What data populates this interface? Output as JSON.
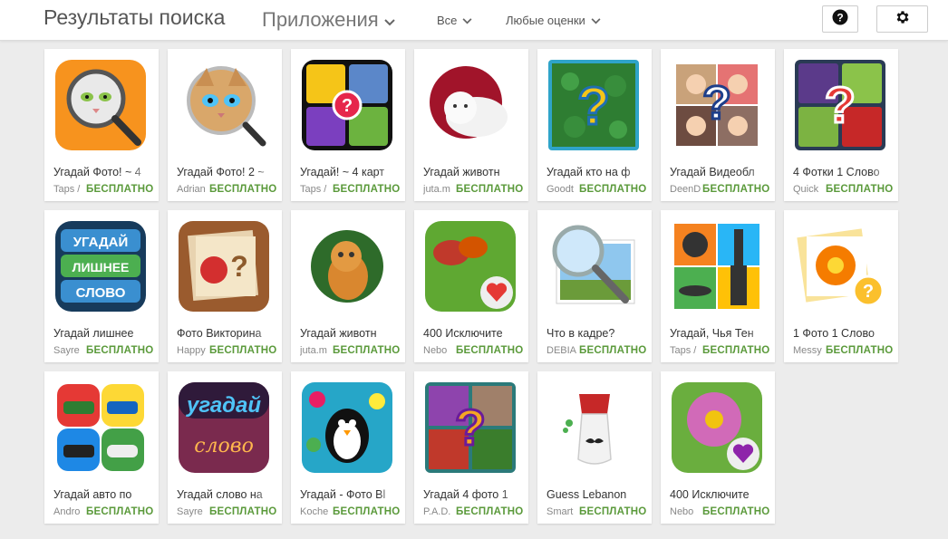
{
  "header": {
    "title": "Результаты поиска",
    "category": "Приложения",
    "filter_all": "Все",
    "filter_rating": "Любые оценки",
    "help_icon": "help-circle-icon",
    "settings_icon": "gear-icon"
  },
  "accent": {
    "price": "#5b9a3b"
  },
  "apps": [
    {
      "title": "Угадай Фото! ~ 4",
      "developer": "Taps / ",
      "price": "БЕСПЛАТНО",
      "icon": "cat-magnifier-orange-icon"
    },
    {
      "title": "Угадай Фото! 2 ~",
      "developer": "Adrian",
      "price": "БЕСПЛАТНО",
      "icon": "cat-magnifier-white-icon"
    },
    {
      "title": "Угадай! ~ 4 карт",
      "developer": "Taps / ",
      "price": "БЕСПЛАТНО",
      "icon": "four-pics-question-icon"
    },
    {
      "title": "Угадай животн",
      "developer": "juta.m",
      "price": "БЕСПЛАТНО",
      "icon": "kitten-red-circle-icon"
    },
    {
      "title": "Угадай кто на ф",
      "developer": "Goodt",
      "price": "БЕСПЛАТНО",
      "icon": "clover-question-icon"
    },
    {
      "title": "Угадай Видеобл",
      "developer": "DeenD",
      "price": "БЕСПЛАТНО",
      "icon": "bloggers-question-icon"
    },
    {
      "title": "4 Фотки 1 Слово",
      "developer": "Quick",
      "price": "БЕСПЛАТНО",
      "icon": "fruits-question-icon"
    },
    {
      "title": "Угадай лишнее",
      "developer": "Sayre",
      "price": "БЕСПЛАТНО",
      "icon": "odd-word-icon"
    },
    {
      "title": "Фото Викторина",
      "developer": "Happy",
      "price": "БЕСПЛАТНО",
      "icon": "apple-photo-quiz-icon"
    },
    {
      "title": "Угадай животн",
      "developer": "juta.m",
      "price": "БЕСПЛАТНО",
      "icon": "kitten-green-circle-icon"
    },
    {
      "title": "400 Исключите",
      "developer": "Nebo",
      "price": "БЕСПЛАТНО",
      "icon": "butterfly-heart-icon"
    },
    {
      "title": "Что в кадре?",
      "developer": "DEBIA",
      "price": "БЕСПЛАТНО",
      "icon": "magnifier-landscape-icon"
    },
    {
      "title": "Угадай, Чья Тен",
      "developer": "Taps / ",
      "price": "БЕСПЛАТНО",
      "icon": "shadows-quiz-icon"
    },
    {
      "title": "1 Фото 1 Слово",
      "developer": "Messy",
      "price": "БЕСПЛАТНО",
      "icon": "flower-photos-question-icon"
    },
    {
      "title": "Угадай авто по",
      "developer": "Andro",
      "price": "БЕСПЛАТНО",
      "icon": "cars-quiz-icon"
    },
    {
      "title": "Угадай слово на",
      "developer": "Sayre",
      "price": "БЕСПЛАТНО",
      "icon": "guess-word-neon-icon"
    },
    {
      "title": "Угадай - Фото Bl",
      "developer": "Koche",
      "price": "БЕСПЛАТНО",
      "icon": "penguin-balloons-icon"
    },
    {
      "title": "Угадай 4 фото 1",
      "developer": "P.A.D.",
      "price": "БЕСПЛАТНО",
      "icon": "four-photos-question-icon"
    },
    {
      "title": "Guess Lebanon",
      "developer": "Smart",
      "price": "БЕСПЛАТНО",
      "icon": "fez-mustache-icon"
    },
    {
      "title": "400 Исключите",
      "developer": "Nebo",
      "price": "БЕСПЛАТНО",
      "icon": "flower-heart-icon"
    }
  ]
}
